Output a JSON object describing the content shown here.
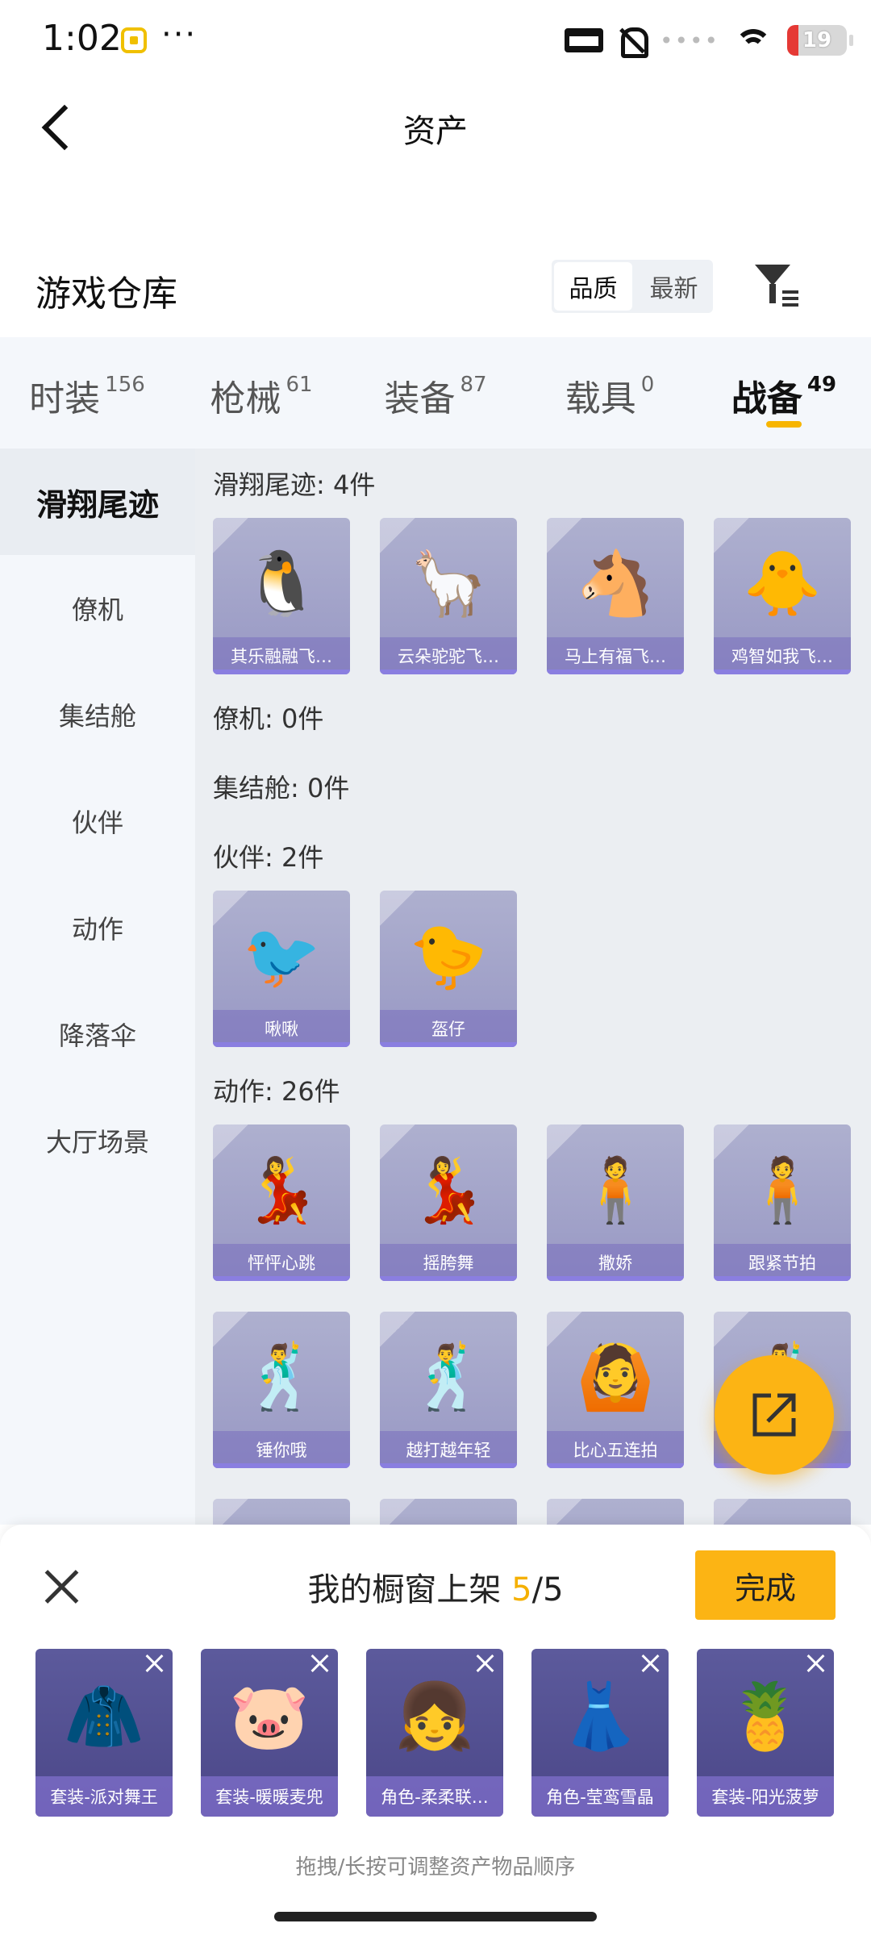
{
  "status_bar": {
    "time": "1:02",
    "dots": "···",
    "signal": "••••",
    "battery": "19"
  },
  "header": {
    "title": "资产"
  },
  "warehouse": {
    "title": "游戏仓库",
    "sort_options": [
      {
        "label": "品质",
        "active": true
      },
      {
        "label": "最新",
        "active": false
      }
    ]
  },
  "category_tabs": [
    {
      "label": "时装",
      "count": "156"
    },
    {
      "label": "枪械",
      "count": "61"
    },
    {
      "label": "装备",
      "count": "87"
    },
    {
      "label": "载具",
      "count": "0"
    },
    {
      "label": "战备",
      "count": "49",
      "active": true
    }
  ],
  "side_nav": [
    {
      "label": "滑翔尾迹",
      "active": true
    },
    {
      "label": "僚机"
    },
    {
      "label": "集结舱"
    },
    {
      "label": "伙伴"
    },
    {
      "label": "动作"
    },
    {
      "label": "降落伞"
    },
    {
      "label": "大厅场景"
    }
  ],
  "sections": [
    {
      "title": "滑翔尾迹: 4件",
      "items": [
        {
          "name": "其乐融融飞…",
          "glyph": "🐧"
        },
        {
          "name": "云朵驼驼飞…",
          "glyph": "🦙"
        },
        {
          "name": "马上有福飞…",
          "glyph": "🐴"
        },
        {
          "name": "鸡智如我飞…",
          "glyph": "🐥"
        }
      ]
    },
    {
      "title": "僚机: 0件",
      "items": []
    },
    {
      "title": "集结舱: 0件",
      "items": []
    },
    {
      "title": "伙伴: 2件",
      "items": [
        {
          "name": "啾啾",
          "glyph": "🐦"
        },
        {
          "name": "盔仔",
          "glyph": "🐤"
        }
      ]
    },
    {
      "title": "动作: 26件",
      "items": [
        {
          "name": "怦怦心跳",
          "glyph": "💃"
        },
        {
          "name": "摇胯舞",
          "glyph": "💃"
        },
        {
          "name": "撒娇",
          "glyph": "🧍"
        },
        {
          "name": "跟紧节拍",
          "glyph": "🧍"
        },
        {
          "name": "锤你哦",
          "glyph": "🕺"
        },
        {
          "name": "越打越年轻",
          "glyph": "🕺"
        },
        {
          "name": "比心五连拍",
          "glyph": "🙆"
        },
        {
          "name": "",
          "glyph": "🕺"
        },
        {
          "name": "",
          "glyph": "🧍"
        },
        {
          "name": "",
          "glyph": "✨"
        },
        {
          "name": "",
          "glyph": "🧍"
        },
        {
          "name": "",
          "glyph": "🧍"
        }
      ]
    }
  ],
  "bottom_panel": {
    "title_prefix": "我的橱窗上架",
    "count_current": "5",
    "count_total": "/5",
    "done_label": "完成",
    "showcase": [
      {
        "name": "套装-派对舞王",
        "glyph": "🧥"
      },
      {
        "name": "套装-暖暖麦兜",
        "glyph": "🐷"
      },
      {
        "name": "角色-柔柔联…",
        "glyph": "👧"
      },
      {
        "name": "角色-莹鸾雪晶",
        "glyph": "👗"
      },
      {
        "name": "套装-阳光菠萝",
        "glyph": "🍍"
      }
    ],
    "hint": "拖拽/长按可调整资产物品顺序"
  },
  "colors": {
    "accent": "#fcb414",
    "card_bg": "#a3a3ca",
    "showcase_bg": "#55529a"
  }
}
